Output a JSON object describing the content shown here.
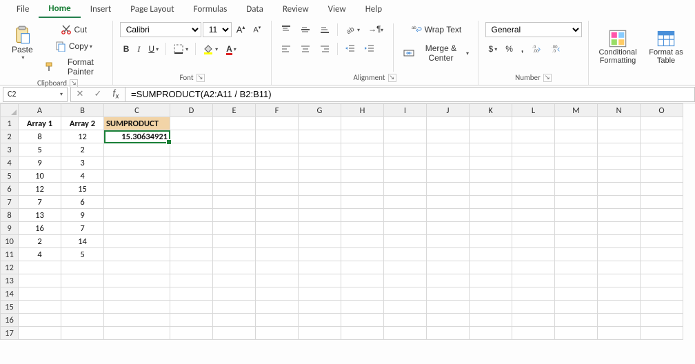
{
  "tabs": [
    "File",
    "Home",
    "Insert",
    "Page Layout",
    "Formulas",
    "Data",
    "Review",
    "View",
    "Help"
  ],
  "activeTab": "Home",
  "clipboard": {
    "paste": "Paste",
    "cut": "Cut",
    "copy": "Copy",
    "painter": "Format Painter",
    "label": "Clipboard"
  },
  "font": {
    "name": "Calibri",
    "size": "11",
    "label": "Font"
  },
  "alignment": {
    "wrap": "Wrap Text",
    "merge": "Merge & Center",
    "label": "Alignment"
  },
  "number": {
    "format": "General",
    "label": "Number"
  },
  "styles": {
    "cond": "Conditional Formatting",
    "table": "Format as Table"
  },
  "nameBox": "C2",
  "formula": "=SUMPRODUCT(A2:A11 / B2:B11)",
  "columns": [
    "A",
    "B",
    "C",
    "D",
    "E",
    "F",
    "G",
    "H",
    "I",
    "J",
    "K",
    "L",
    "M",
    "N",
    "O"
  ],
  "rowCount": 17,
  "chart_data": {
    "type": "table",
    "headers": [
      "Array 1",
      "Array 2",
      "SUMPRODUCT"
    ],
    "rows": [
      {
        "A": "8",
        "B": "12",
        "C": "15.30634921"
      },
      {
        "A": "5",
        "B": "2"
      },
      {
        "A": "9",
        "B": "3"
      },
      {
        "A": "10",
        "B": "4"
      },
      {
        "A": "12",
        "B": "15"
      },
      {
        "A": "7",
        "B": "6"
      },
      {
        "A": "13",
        "B": "9"
      },
      {
        "A": "16",
        "B": "7"
      },
      {
        "A": "2",
        "B": "14"
      },
      {
        "A": "4",
        "B": "5"
      }
    ]
  }
}
